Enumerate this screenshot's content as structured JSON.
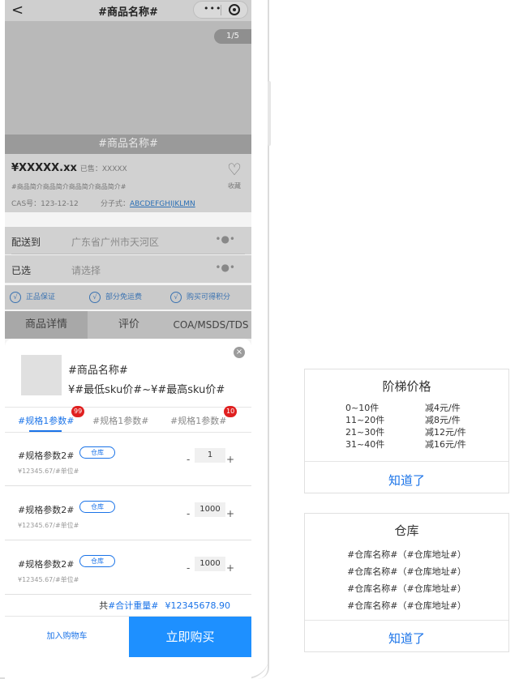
{
  "nav": {
    "title": "#商品名称#",
    "back": "<",
    "more": "•••"
  },
  "gallery": {
    "indicator": "1/5",
    "name_band": "#商品名称#"
  },
  "product": {
    "price": "¥XXXXX.xx",
    "sold": "已售：XXXXX",
    "favorite": "收藏",
    "intro": "#商品简介商品简介商品简介商品简介#",
    "cas": "CAS号：123-12-12",
    "formula_label": "分子式：",
    "formula_value": "ABCDEFGHIJKLMN"
  },
  "rows": {
    "delivery_label": "配送到",
    "delivery_value": "广东省广州市天河区",
    "selected_label": "已选",
    "selected_value": "请选择",
    "more": "•●•"
  },
  "guarantees": [
    "正品保证",
    "部分免运费",
    "购买可得积分"
  ],
  "tabs": [
    "商品详情",
    "评价",
    "COA/MSDS/TDS"
  ],
  "sheet": {
    "name": "#商品名称#",
    "price_range": "¥#最低sku价#~¥#最高sku价#",
    "close": "×",
    "spec_tabs": [
      {
        "label": "#规格1参数#",
        "badge": "99"
      },
      {
        "label": "#规格1参数#",
        "badge": ""
      },
      {
        "label": "#规格1参数#",
        "badge": "10"
      }
    ],
    "spec_rows": [
      {
        "name": "#规格参数2#",
        "tag": "仓库",
        "unit_price": "¥12345.67/#单位#",
        "qty": "1"
      },
      {
        "name": "#规格参数2#",
        "tag": "仓库",
        "unit_price": "¥12345.67/#单位#",
        "qty": "1000"
      },
      {
        "name": "#规格参数2#",
        "tag": "仓库",
        "unit_price": "¥12345.67/#单位#",
        "qty": "1000"
      }
    ],
    "stepper_minus": "-",
    "stepper_plus": "+",
    "summary_prefix": "共",
    "summary_weight": "#合计重量#",
    "summary_total": "¥12345678.90",
    "add_to_cart": "加入购物车",
    "buy_now": "立即购买"
  },
  "tier_dialog": {
    "title": "阶梯价格",
    "tiers": [
      {
        "range": "0~10件",
        "discount": "减4元/件"
      },
      {
        "range": "11~20件",
        "discount": "减8元/件"
      },
      {
        "range": "21~30件",
        "discount": "减12元/件"
      },
      {
        "range": "31~40件",
        "discount": "减16元/件"
      }
    ],
    "ok": "知道了"
  },
  "warehouse_dialog": {
    "title": "仓库",
    "lines": [
      "#仓库名称#（#仓库地址#）",
      "#仓库名称#（#仓库地址#）",
      "#仓库名称#（#仓库地址#）",
      "#仓库名称#（#仓库地址#）"
    ],
    "ok": "知道了"
  }
}
